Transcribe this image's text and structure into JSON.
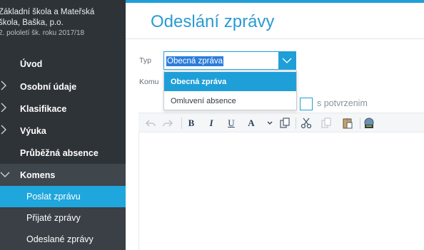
{
  "sidebar": {
    "school_name_line1": "Základní škola a Mateřská",
    "school_name_line2": "škola, Baška, p.o.",
    "term": "2. pololetí šk. roku 2017/18",
    "items": [
      {
        "label": "Úvod",
        "chevron": ""
      },
      {
        "label": "Osobní údaje",
        "chevron": "›"
      },
      {
        "label": "Klasifikace",
        "chevron": "›"
      },
      {
        "label": "Výuka",
        "chevron": "›"
      },
      {
        "label": "Průběžná absence",
        "chevron": ""
      },
      {
        "label": "Komens",
        "chevron": "⌄"
      }
    ],
    "subitems": [
      {
        "label": "Poslat zprávu"
      },
      {
        "label": "Přijaté zprávy"
      },
      {
        "label": "Odeslané zprávy"
      }
    ]
  },
  "main": {
    "title": "Odeslání zprávy",
    "typ_label": "Typ",
    "komu_label": "Komu",
    "select_value": "Obecná zpráva",
    "options": [
      "Obecná zpráva",
      "Omluvení absence"
    ],
    "confirm_label": "s potvrzenim"
  },
  "toolbar": {
    "bold": "B",
    "italic": "I",
    "underline": "U",
    "font_color": "A"
  },
  "colors": {
    "accent": "#1f9fd8",
    "sidebar_bg": "#2e3338",
    "active_item": "#1fa6dc"
  }
}
